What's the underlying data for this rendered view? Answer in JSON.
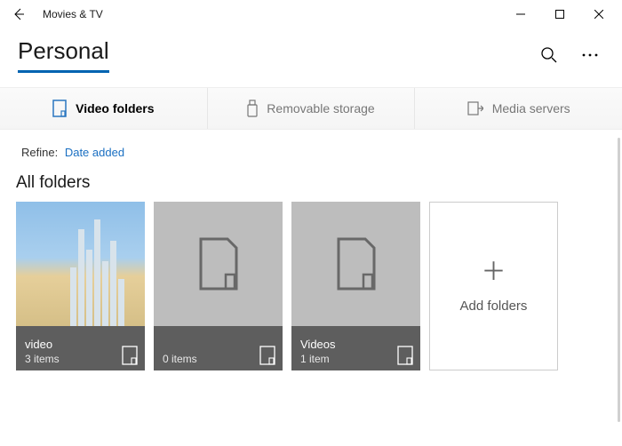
{
  "window": {
    "title": "Movies & TV"
  },
  "page": {
    "title": "Personal"
  },
  "tabs": [
    {
      "label": "Video folders",
      "active": true
    },
    {
      "label": "Removable storage",
      "active": false
    },
    {
      "label": "Media servers",
      "active": false
    }
  ],
  "refine": {
    "label": "Refine:",
    "value": "Date added"
  },
  "section": {
    "title": "All folders"
  },
  "folders": [
    {
      "name": "video",
      "count": "3 items",
      "hasImage": true
    },
    {
      "name": "",
      "count": "0 items",
      "hasImage": false
    },
    {
      "name": "Videos",
      "count": "1 item",
      "hasImage": false
    }
  ],
  "addTile": {
    "label": "Add folders"
  }
}
